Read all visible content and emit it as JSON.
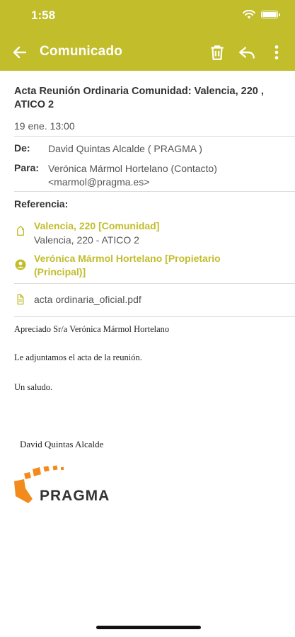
{
  "status_bar": {
    "time": "1:58"
  },
  "toolbar": {
    "title": "Comunicado"
  },
  "message": {
    "subject": "Acta Reunión Ordinaria Comunidad: Valencia, 220 , ATICO 2",
    "date": "19 ene. 13:00",
    "from_label": "De:",
    "from_value": "David Quintas Alcalde ( PRAGMA )",
    "to_label": "Para:",
    "to_value": "Verónica Mármol Hortelano (Contacto) <marmol@pragma.es>",
    "reference_label": "Referencia:",
    "references": [
      {
        "title": "Valencia, 220 [Comunidad]",
        "subtitle": "Valencia, 220 - ATICO 2",
        "icon": "tag-icon"
      },
      {
        "title": "Verónica Mármol Hortelano [Propietario (Principal)]",
        "subtitle": "",
        "icon": "person-icon"
      }
    ],
    "attachment": {
      "name": "acta ordinaria_oficial.pdf",
      "icon": "attachment-icon"
    },
    "body": {
      "greeting": "Apreciado Sr/a Verónica Mármol Hortelano",
      "line1": "Le adjuntamos el acta de la reunión.",
      "closing": "Un saludo.",
      "signature": "David Quintas Alcalde"
    },
    "logo_text": "PRAGMA"
  },
  "colors": {
    "accent": "#c2bd2b",
    "logo_orange": "#f28a1c"
  }
}
